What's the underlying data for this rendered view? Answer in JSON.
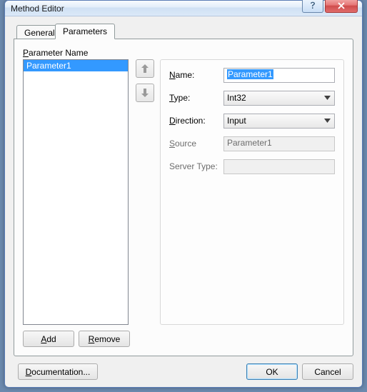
{
  "window": {
    "title": "Method Editor"
  },
  "tabs": {
    "general": "General",
    "parameters": "Parameters",
    "active": "parameters"
  },
  "list": {
    "header_pre": "P",
    "header_mid": "arameter Name",
    "items": [
      {
        "label": "Parameter1",
        "selected": true
      }
    ],
    "add_pre": "A",
    "add": "dd",
    "remove_pre": "R",
    "remove": "emove"
  },
  "fields": {
    "name_pre": "N",
    "name_label": "ame:",
    "name_value": "Parameter1",
    "type_pre": "T",
    "type_label": "ype:",
    "type_value": "Int32",
    "dir_pre": "D",
    "dir_label": "irection:",
    "dir_value": "Input",
    "src_pre": "S",
    "src_label": "ource",
    "src_value": "Parameter1",
    "srv_label": "Server Type:",
    "srv_value": ""
  },
  "footer": {
    "doc_pre": "D",
    "doc": "ocumentation...",
    "ok": "OK",
    "cancel": "Cancel"
  }
}
